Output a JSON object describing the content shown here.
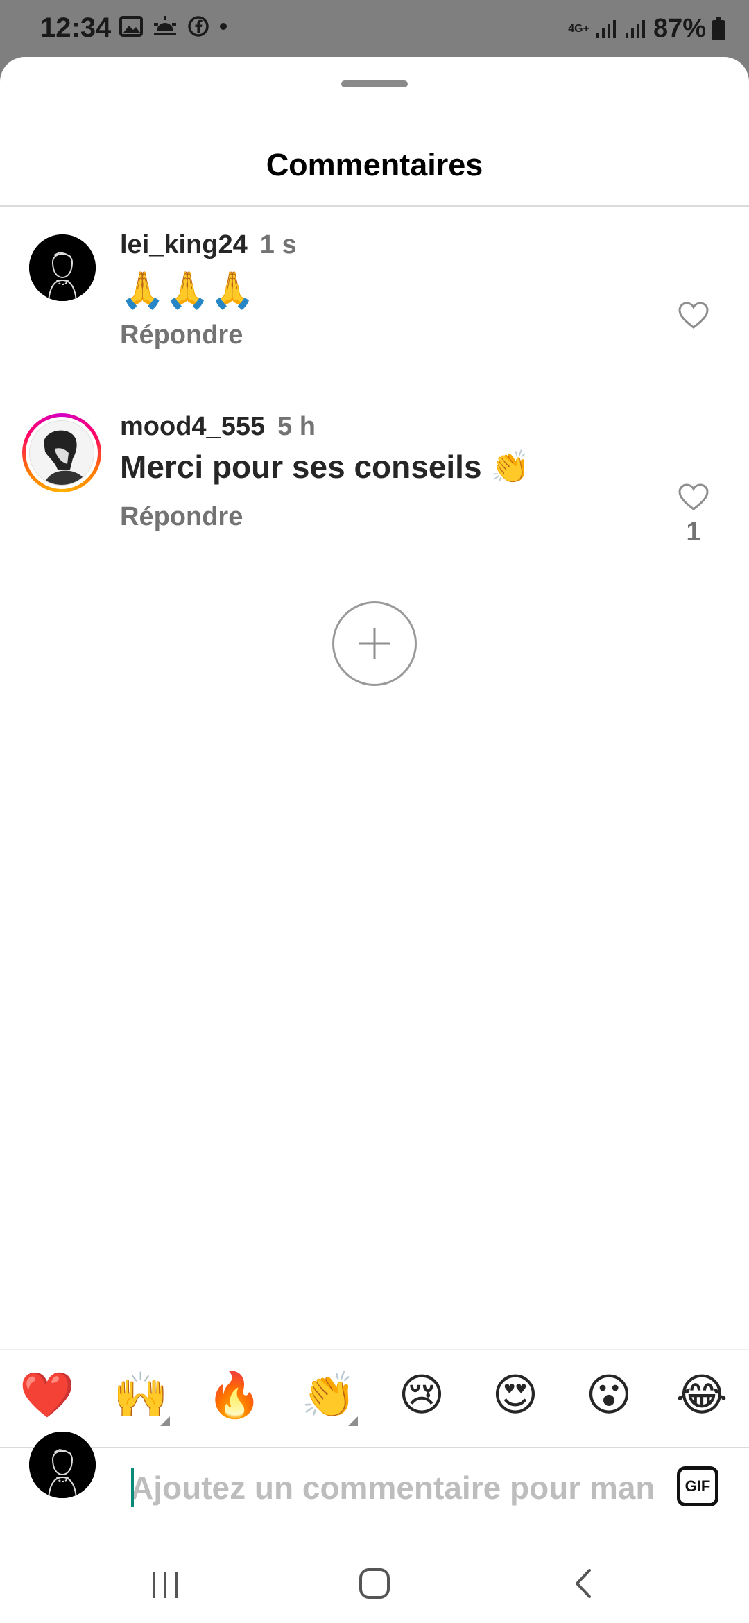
{
  "status_bar": {
    "time": "12:34",
    "network": "4G+",
    "battery": "87%"
  },
  "sheet": {
    "title": "Commentaires"
  },
  "comments": [
    {
      "username": "lei_king24",
      "time": "1 s",
      "text": "🙏🙏🙏",
      "reply_label": "Répondre",
      "likes": "",
      "avatar_ring": false
    },
    {
      "username": "mood4_555",
      "time": "5 h",
      "text": "Merci pour ses conseils 👏",
      "reply_label": "Répondre",
      "likes": "1",
      "avatar_ring": true
    }
  ],
  "emoji_bar": {
    "emojis": [
      "❤️",
      "🙌",
      "🔥",
      "👏",
      "😢",
      "😍",
      "😮",
      "😂"
    ]
  },
  "composer": {
    "placeholder": "Ajoutez un commentaire pour man",
    "value": "",
    "gif_label": "GIF"
  },
  "colors": {
    "accent_caret": "#0a8a7a",
    "text_primary": "#262626",
    "text_secondary": "#737373"
  }
}
